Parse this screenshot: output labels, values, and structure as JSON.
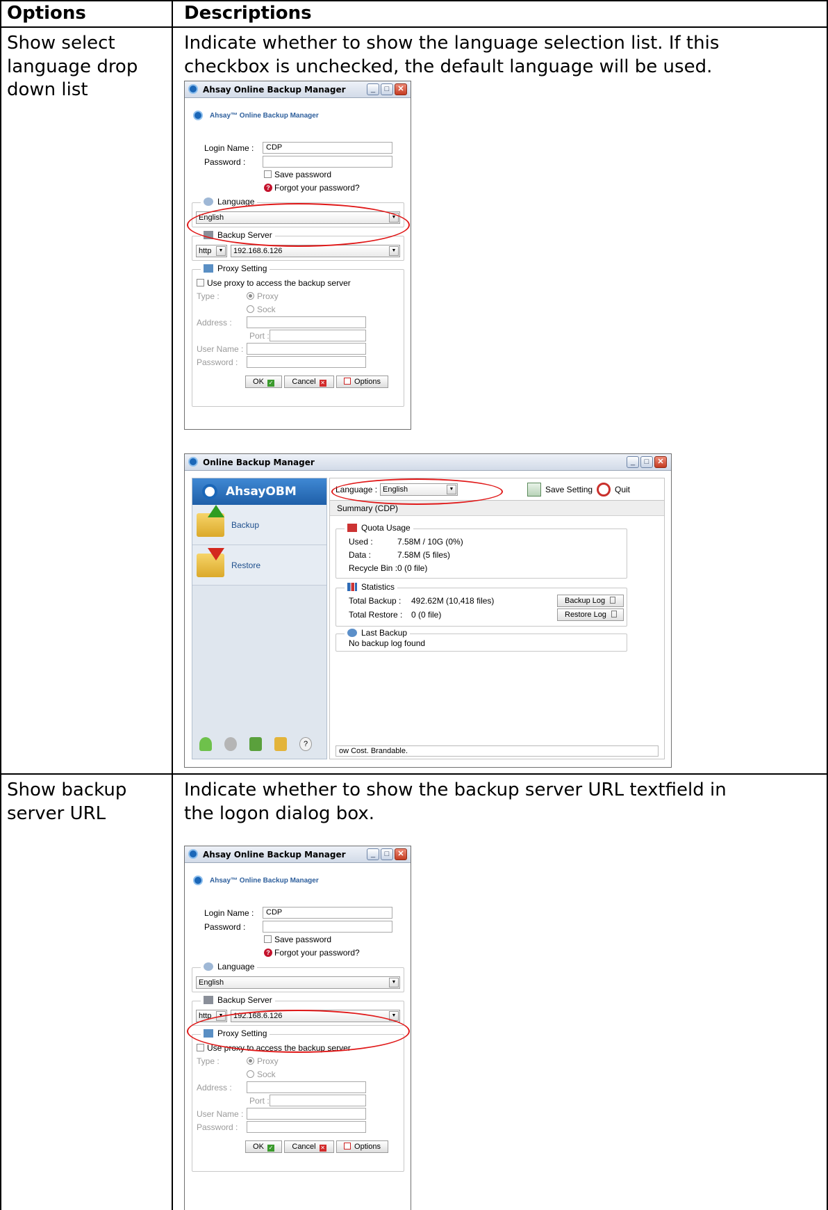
{
  "table": {
    "header_options": "Options",
    "header_descriptions": "Descriptions",
    "rows": [
      {
        "option_lines": [
          "Show select",
          "language drop",
          "down list"
        ],
        "desc_lines": [
          "Indicate whether to show the language selection list. If this",
          "checkbox is unchecked, the default language will be used."
        ]
      },
      {
        "option_lines": [
          "Show backup",
          "server URL"
        ],
        "desc_lines": [
          "Indicate whether to show the backup server URL textfield in",
          "the logon dialog box."
        ]
      }
    ]
  },
  "login_dialog": {
    "title": "Ahsay Online Backup Manager",
    "brand": "Ahsay™ Online Backup Manager",
    "login_name_label": "Login Name :",
    "login_name_value": "CDP",
    "password_label": "Password :",
    "save_password": "Save password",
    "forgot_password": "Forgot your password?",
    "language_legend": "Language",
    "language_value": "English",
    "backup_server_legend": "Backup Server",
    "protocol_value": "http",
    "server_value": "192.168.6.126",
    "proxy_legend": "Proxy Setting",
    "use_proxy": "Use proxy to access the backup server",
    "type_label": "Type :",
    "proxy_option": "Proxy",
    "sock_option": "Sock",
    "address_label": "Address :",
    "port_label": "Port :",
    "user_name_label": "User Name :",
    "proxy_password_label": "Password :",
    "ok_button": "OK",
    "cancel_button": "Cancel",
    "options_button": "Options"
  },
  "main_window": {
    "title": "Online Backup Manager",
    "sidebar_brand": "AhsayOBM",
    "backup_item": "Backup",
    "restore_item": "Restore",
    "language_label": "Language :",
    "language_value": "English",
    "save_setting": "Save Setting",
    "quit": "Quit",
    "summary_title": "Summary (CDP)",
    "quota_legend": "Quota Usage",
    "used_label": "Used :",
    "used_value": "7.58M / 10G (0%)",
    "data_label": "Data :",
    "data_value": "7.58M  (5 files)",
    "recycle_label": "Recycle Bin :",
    "recycle_value": "0  (0 file)",
    "statistics_legend": "Statistics",
    "total_backup_label": "Total Backup :",
    "total_backup_value": "492.62M  (10,418 files)",
    "total_restore_label": "Total Restore :",
    "total_restore_value": "0  (0 file)",
    "backup_log_button": "Backup Log",
    "restore_log_button": "Restore Log",
    "last_backup_legend": "Last Backup",
    "last_backup_value": "No backup log found",
    "status_text": "ow Cost. Brandable."
  },
  "colors": {
    "highlight_ellipse": "#e01818",
    "title_blue": "#1f5fa8"
  }
}
